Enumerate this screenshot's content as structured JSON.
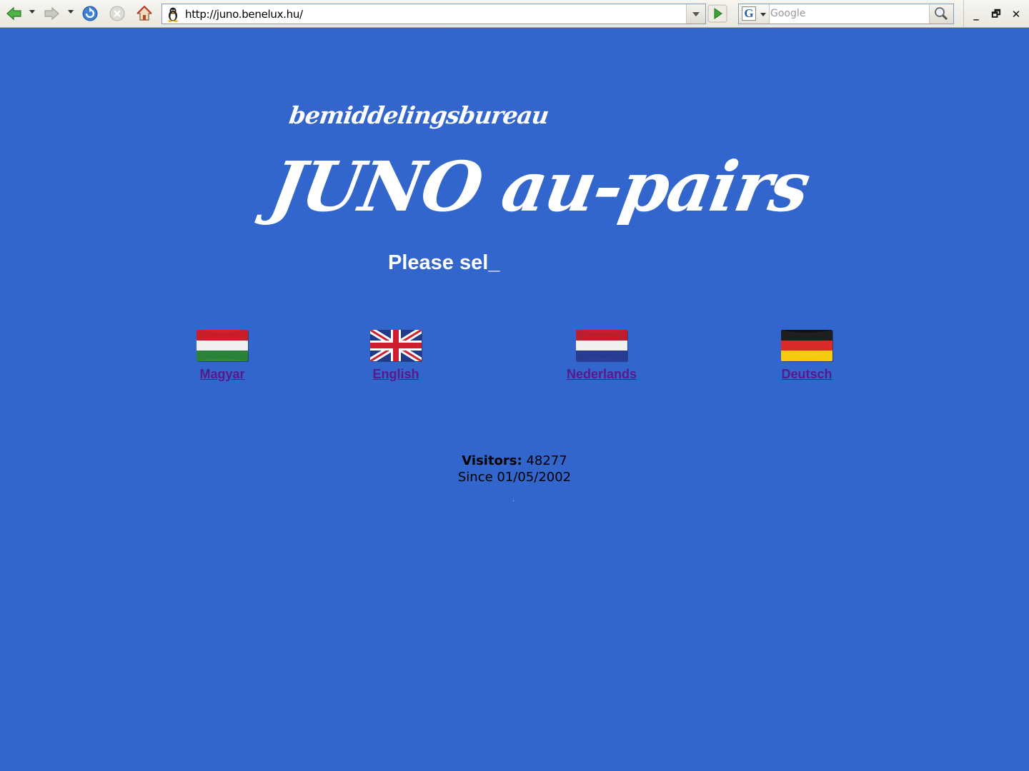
{
  "browser": {
    "url": "http://juno.benelux.hu/",
    "search_placeholder": "Google",
    "search_engine_letter": "G",
    "window_controls": [
      "_",
      "🗗",
      "✕"
    ]
  },
  "page": {
    "subtitle": "bemiddelingsbureau",
    "title": "JUNO au-pairs",
    "prompt": "Please sel_",
    "languages": [
      {
        "label": "Magyar",
        "flag": "hungary-flag"
      },
      {
        "label": "English",
        "flag": "uk-flag"
      },
      {
        "label": "Nederlands",
        "flag": "netherlands-flag"
      },
      {
        "label": "Deutsch",
        "flag": "germany-flag"
      }
    ],
    "visitors_label": "Visitors:",
    "visitors_count": "48277",
    "since_text": "Since 01/05/2002"
  },
  "colors": {
    "page_background": "#3366cc",
    "link_visited": "#551a8b",
    "heading_text": "#ffffff"
  }
}
